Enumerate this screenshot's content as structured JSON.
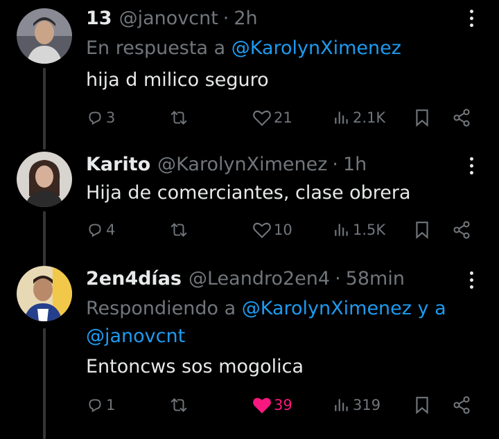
{
  "tweets": [
    {
      "name": "13",
      "handle": "@janovcnt",
      "dot": "·",
      "time": "2h",
      "reply_prefix": "En respuesta a",
      "reply_mention_1": "@KarolynXimenez",
      "text": "hija d milico seguro",
      "replies": "3",
      "likes": "21",
      "views": "2.1K",
      "liked": false
    },
    {
      "name": "Karito",
      "handle": "@KarolynXimenez",
      "dot": "·",
      "time": "1h",
      "text": "Hija de comerciantes, clase obrera",
      "replies": "4",
      "likes": "10",
      "views": "1.5K",
      "liked": false
    },
    {
      "name": "2en4días",
      "handle": "@Leandro2en4",
      "dot": "·",
      "time": "58min",
      "reply_prefix": "Respondiendo a",
      "reply_mention_1": "@KarolynXimenez y a",
      "reply_mention_2": "@janovcnt",
      "text": "Entoncws sos mogolica",
      "replies": "1",
      "likes": "39",
      "views": "319",
      "liked": true
    }
  ],
  "colors": {
    "background": "#000000",
    "text": "#e7e9ea",
    "muted": "#71767b",
    "link": "#1d9bf0",
    "like": "#f91880"
  },
  "icons": [
    "reply-icon",
    "retweet-icon",
    "like-icon",
    "views-icon",
    "bookmark-icon",
    "share-icon",
    "more-icon"
  ]
}
